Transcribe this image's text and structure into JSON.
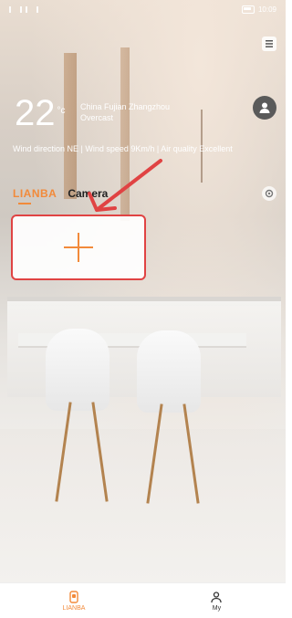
{
  "status_bar": {
    "left_icons": [
      "sim-signal-icon",
      "wifi-signal-icon"
    ],
    "time": "10:09"
  },
  "weather": {
    "temperature": "22",
    "unit": "°c",
    "location": "China  Fujian  Zhangzhou",
    "condition": "Overcast",
    "details": "Wind direction NE  | Wind speed 9Km/h | Air quality Excellent"
  },
  "tabs": [
    {
      "label": "LIANBA",
      "active": true
    },
    {
      "label": "Camera",
      "active": false
    }
  ],
  "add_device": {
    "icon": "plus-icon",
    "color": "#f28a3a",
    "highlight_color": "#e04343"
  },
  "bottom_nav": [
    {
      "label": "LIANBA",
      "icon": "home-device-icon",
      "active": true
    },
    {
      "label": "My",
      "icon": "person-icon",
      "active": false
    }
  ],
  "colors": {
    "accent": "#f28a3a",
    "annotation_red": "#e04343"
  }
}
